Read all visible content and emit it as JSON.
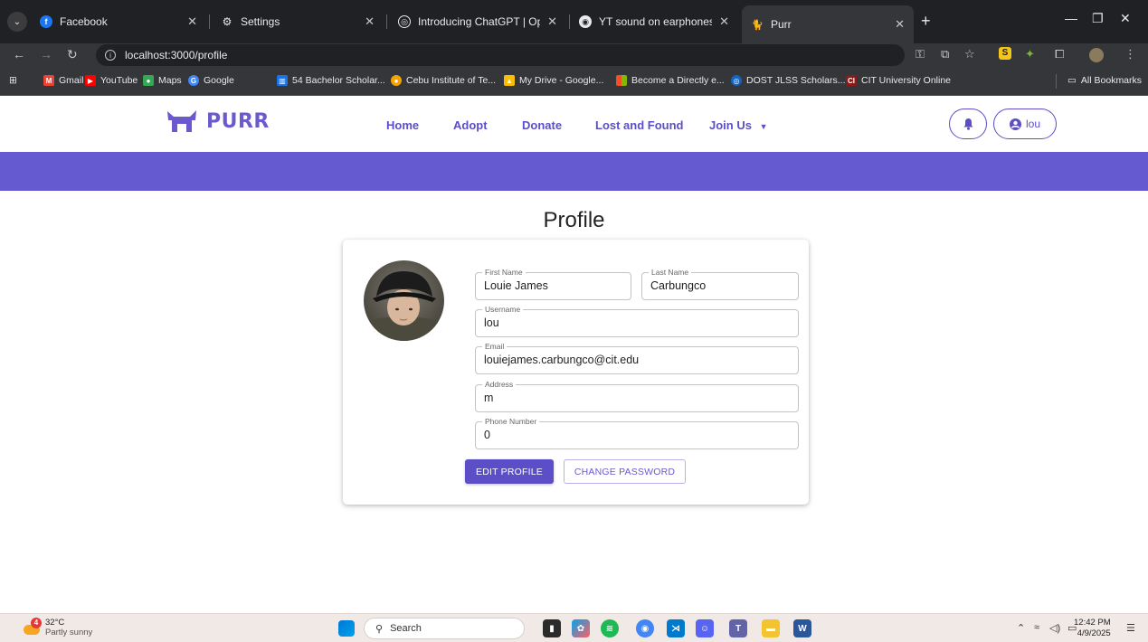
{
  "browser": {
    "tabs": [
      {
        "title": "Facebook",
        "active": false
      },
      {
        "title": "Settings",
        "active": false
      },
      {
        "title": "Introducing ChatGPT | OpenAI",
        "active": false
      },
      {
        "title": "YT sound on earphones",
        "active": false
      },
      {
        "title": "Purr",
        "active": true
      }
    ],
    "url": "localhost:3000/profile",
    "bookmarks": [
      "Gmail",
      "YouTube",
      "Maps",
      "Google",
      "54 Bachelor Scholar...",
      "Cebu Institute of Te...",
      "My Drive - Google...",
      "Become a Directly e...",
      "DOST JLSS Scholars...",
      "CIT University Online"
    ],
    "all_bookmarks": "All Bookmarks"
  },
  "app": {
    "logo": "PURR",
    "nav": {
      "home": "Home",
      "adopt": "Adopt",
      "donate": "Donate",
      "lost_found": "Lost and Found",
      "join_us": "Join Us"
    },
    "user": "lou"
  },
  "profile": {
    "title": "Profile",
    "fields": {
      "first_name": {
        "label": "First Name",
        "value": "Louie James"
      },
      "last_name": {
        "label": "Last Name",
        "value": "Carbungco"
      },
      "username": {
        "label": "Username",
        "value": "lou"
      },
      "email": {
        "label": "Email",
        "value": "louiejames.carbungco@cit.edu"
      },
      "address": {
        "label": "Address",
        "value": "m"
      },
      "phone": {
        "label": "Phone Number",
        "value": "0"
      }
    },
    "edit_button": "EDIT PROFILE",
    "password_button": "CHANGE PASSWORD"
  },
  "taskbar": {
    "weather_badge": "4",
    "temperature": "32°C",
    "weather": "Partly sunny",
    "search": "Search",
    "time": "12:42 PM",
    "date": "4/9/2025"
  },
  "colors": {
    "brand": "#5b4ec6",
    "band": "#665ad1"
  }
}
